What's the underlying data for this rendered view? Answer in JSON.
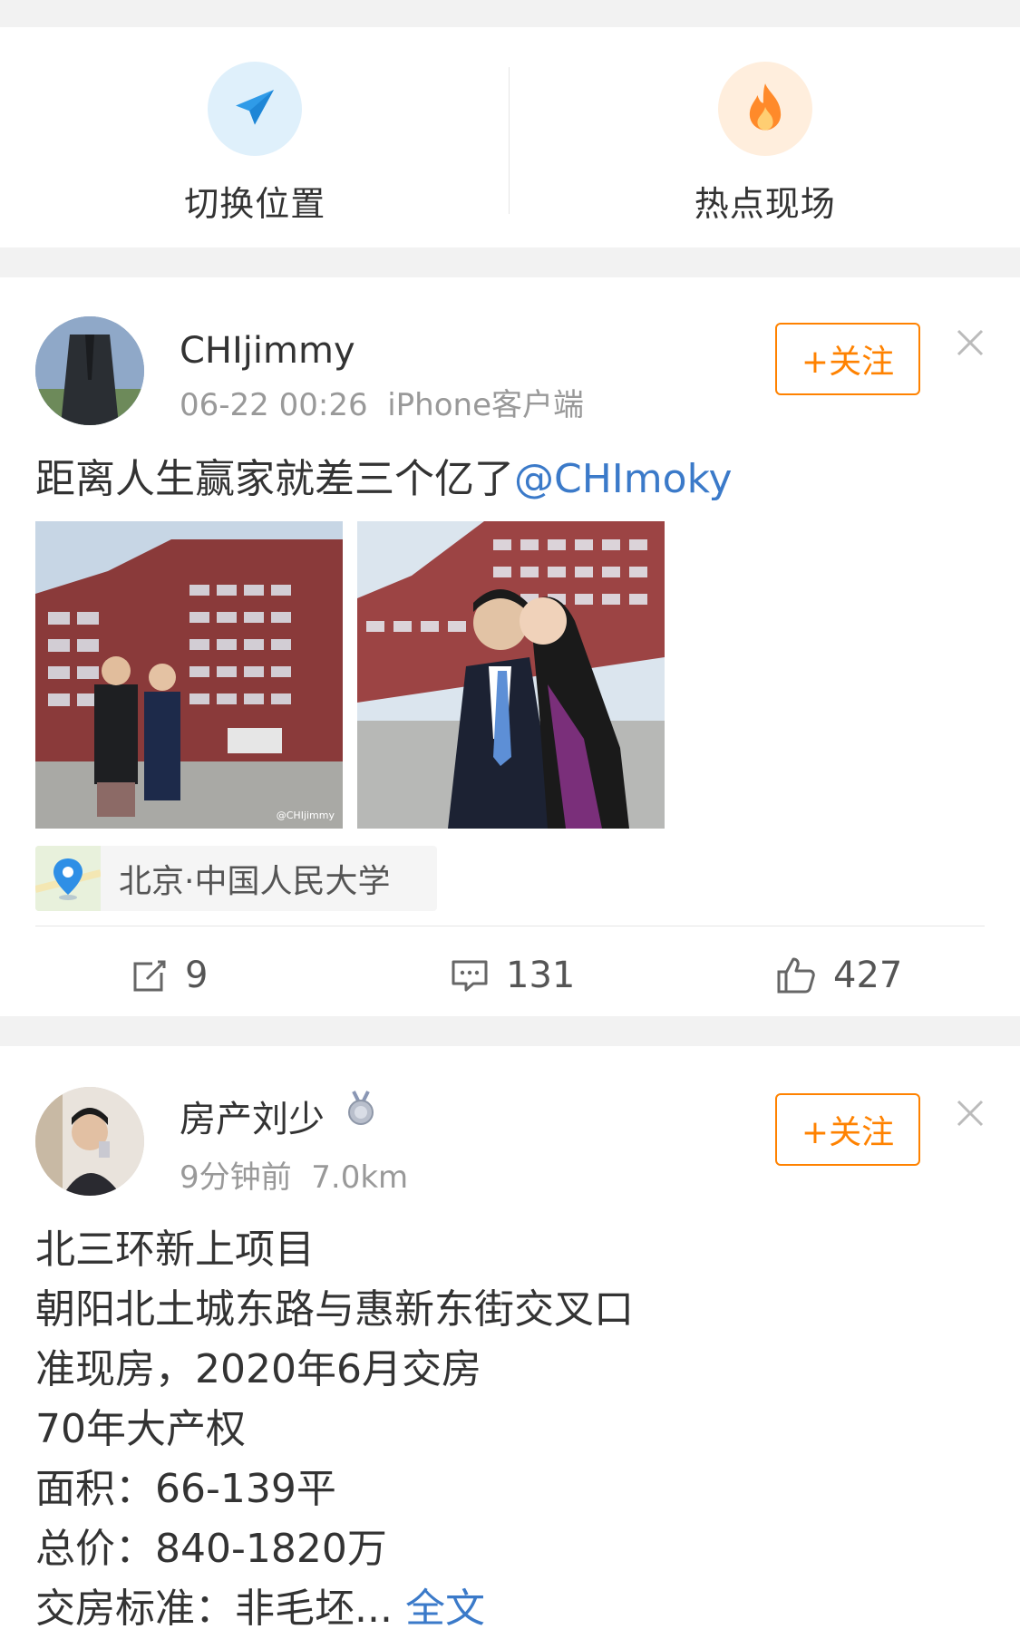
{
  "quick_links": [
    {
      "label": "切换位置",
      "icon": "airplane-icon"
    },
    {
      "label": "热点现场",
      "icon": "fire-icon"
    }
  ],
  "posts": [
    {
      "username": "CHIjimmy",
      "time": "06-22 00:26",
      "source": "iPhone客户端",
      "follow_label": "+关注",
      "text": "距离人生赢家就差三个亿了",
      "mention": "@CHImoky",
      "photo_watermark": "@CHIjimmy",
      "location": "北京·中国人民大学",
      "repost_count": "9",
      "comment_count": "131",
      "like_count": "427"
    },
    {
      "username": "房产刘少",
      "time": "9分钟前",
      "distance": "7.0km",
      "follow_label": "+关注",
      "lines": [
        "北三环新上项目",
        "朝阳北土城东路与惠新东街交叉口",
        "准现房，2020年6月交房",
        "70年大产权",
        "面积：66-139平",
        "总价：840-1820万",
        "交房标准：非毛坯..."
      ],
      "more_label": "全文"
    }
  ],
  "colors": {
    "accent_orange": "#ff8200",
    "link_blue": "#3b7ac9",
    "meta_gray": "#999999"
  }
}
